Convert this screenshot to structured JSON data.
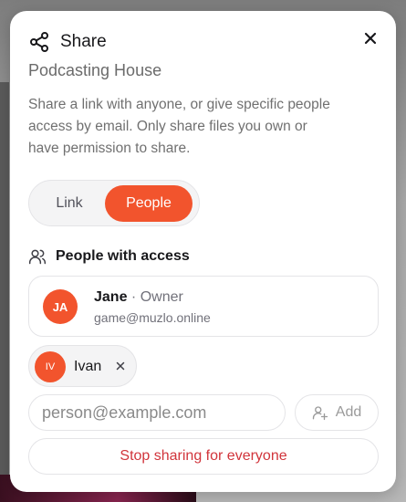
{
  "dialog": {
    "title": "Share",
    "subtitle": "Podcasting House",
    "description": "Share a link with anyone, or give specific people access by email. Only share files you own or have permission to share."
  },
  "toggle": {
    "link_label": "Link",
    "people_label": "People",
    "selected": "People"
  },
  "access": {
    "section_label": "People with access",
    "owner": {
      "initials": "JA",
      "name": "Jane",
      "separator": " · ",
      "role": "Owner",
      "email": "game@muzlo.online"
    },
    "pending": [
      {
        "initials": "IV",
        "name": "Ivan"
      }
    ]
  },
  "invite": {
    "email_value": "",
    "email_placeholder": "person@example.com",
    "add_label": "Add"
  },
  "stop_sharing_label": "Stop sharing for everyone",
  "colors": {
    "accent": "#f2542d",
    "danger": "#d1343b"
  },
  "icons": [
    "share-icon",
    "close-icon",
    "people-icon",
    "remove-icon",
    "add-person-icon"
  ]
}
